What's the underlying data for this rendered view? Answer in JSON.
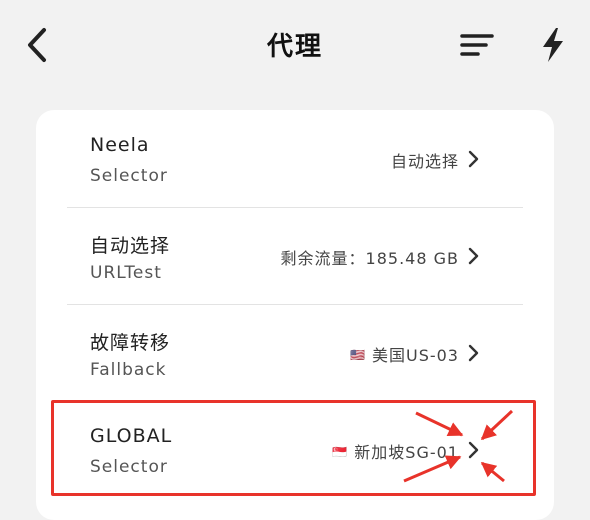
{
  "header": {
    "title": "代理"
  },
  "icons": {
    "back": "chevron-left-icon",
    "sort": "sort-icon",
    "bolt": "bolt-icon",
    "chevron": "chevron-right-icon",
    "flag_us": "us-flag-icon",
    "flag_sg": "singapore-flag-icon"
  },
  "colors": {
    "background": "#f2f2f2",
    "card": "#ffffff",
    "highlight": "#e8332a"
  },
  "proxy_groups": [
    {
      "name": "Neela",
      "type": "Selector",
      "value": "自动选择"
    },
    {
      "name": "自动选择",
      "type": "URLTest",
      "value": "剩余流量：185.48 GB"
    },
    {
      "name": "故障转移",
      "type": "Fallback",
      "value": "美国US-03",
      "flag": "🇺🇸"
    },
    {
      "name": "GLOBAL",
      "type": "Selector",
      "value": "新加坡SG-01",
      "flag": "🇸🇬"
    }
  ]
}
